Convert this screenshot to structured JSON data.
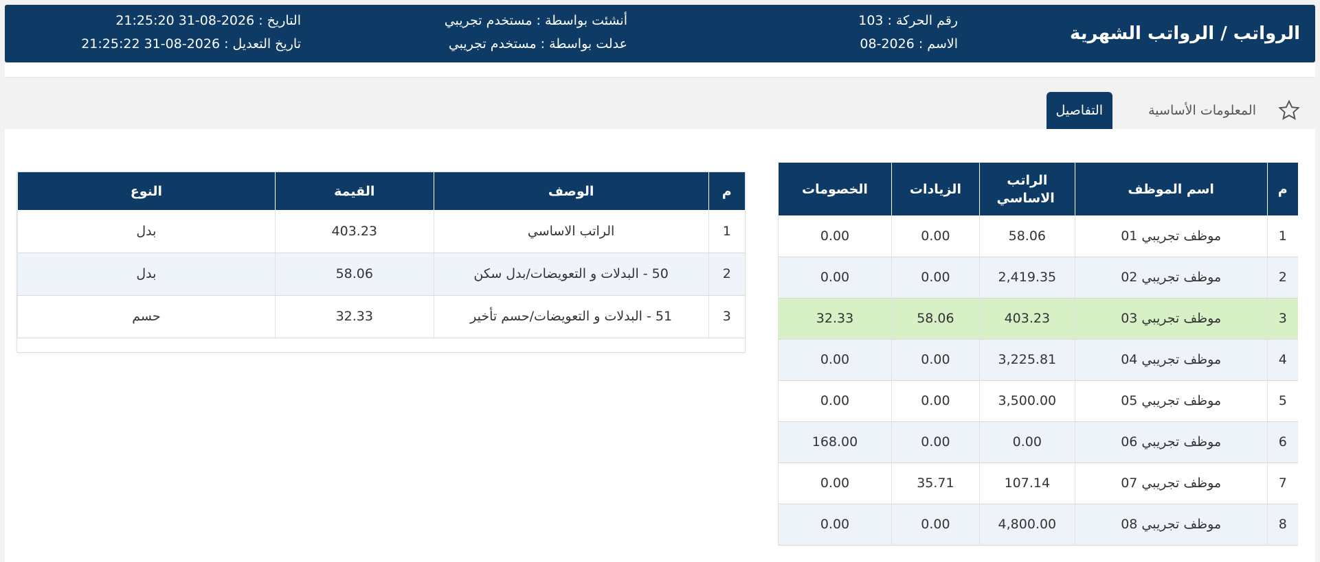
{
  "header": {
    "title": "الرواتب / الرواتب الشهرية",
    "txn_no": "رقم الحركة : 103",
    "name": "الاسم : 2026-08",
    "created_by": "أنشئت بواسطة : مستخدم تجريبي",
    "edited_by": "عدلت بواسطة : مستخدم تجريبي",
    "date": "التاريخ : 2026-08-31 21:25:20",
    "edit_date": "تاريخ التعديل : 2026-08-31 21:25:22"
  },
  "tabs": {
    "basic": "المعلومات الأساسية",
    "details": "التفاصيل",
    "star_icon": "star-icon"
  },
  "employees": {
    "headers": [
      "م",
      "اسم الموظف",
      "الراتب الاساسي",
      "الزيادات",
      "الخصومات"
    ],
    "rows": [
      [
        "1",
        "موظف تجريبي 01",
        "58.06",
        "0.00",
        "0.00"
      ],
      [
        "2",
        "موظف تجريبي 02",
        "2,419.35",
        "0.00",
        "0.00"
      ],
      [
        "3",
        "موظف تجريبي 03",
        "403.23",
        "58.06",
        "32.33"
      ],
      [
        "4",
        "موظف تجريبي 04",
        "3,225.81",
        "0.00",
        "0.00"
      ],
      [
        "5",
        "موظف تجريبي 05",
        "3,500.00",
        "0.00",
        "0.00"
      ],
      [
        "6",
        "موظف تجريبي 06",
        "0.00",
        "0.00",
        "168.00"
      ],
      [
        "7",
        "موظف تجريبي 07",
        "107.14",
        "35.71",
        "0.00"
      ],
      [
        "8",
        "موظف تجريبي 08",
        "4,800.00",
        "0.00",
        "0.00"
      ]
    ],
    "selected_index": 2,
    "selected_color": "#d7f0c5"
  },
  "details": {
    "headers": [
      "م",
      "الوصف",
      "القيمة",
      "النوع"
    ],
    "rows": [
      [
        "1",
        "الراتب الاساسي",
        "403.23",
        "بدل"
      ],
      [
        "2",
        "50 - البدلات و التعويضات/بدل سكن",
        "58.06",
        "بدل"
      ],
      [
        "3",
        "51 - البدلات و التعويضات/حسم تأخير",
        "32.33",
        "حسم"
      ]
    ]
  },
  "colors": {
    "primary": "#0d3b66",
    "row_alt": "#edf3f9"
  }
}
